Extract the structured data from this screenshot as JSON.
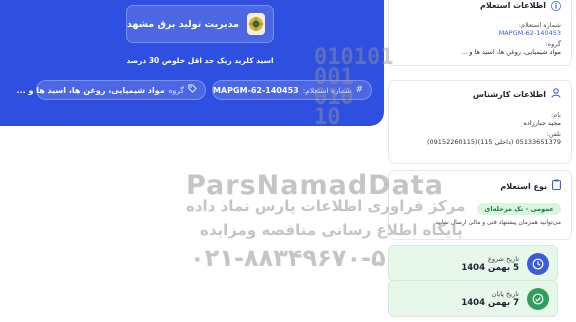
{
  "banner": {
    "org_name": "مدیریت تولید برق مشهد",
    "title": "اسید کلرید ریک حد اقل خلوص 30 درصد",
    "number_label": "شماره استعلام:",
    "number_value": "MAPGM-62-140453",
    "group_label": "گروه",
    "group_value": "مواد شیمیایی، روغن ها، اسید ها و ..."
  },
  "inquiry_info": {
    "title": "اطلاعات استعلام",
    "number_label": "شماره استعلام:",
    "number_value": "MAPGM-62-140453",
    "group_label": "گروه:",
    "group_value": "مواد شیمیایی، روغن ها، اسید ها و ..."
  },
  "expert_info": {
    "title": "اطلاعات کارشناس",
    "name_label": "نام:",
    "name_value": "مجید جبارزاده",
    "phone_label": "تلفن:",
    "phone_value": "05133651379 (داخلی 115)(09152260115)"
  },
  "inquiry_type": {
    "title": "نوع استعلام",
    "chip": "عمومی - تک مرحله‌ای",
    "note": "می‌توانید همزمان پیشنهاد فنی و مالی ارسال نمایید"
  },
  "dates": {
    "start_label": "تاریخ شروع",
    "start_value": "5 بهمن 1404",
    "end_label": "تاریخ پایان",
    "end_value": "7 بهمن 1404"
  },
  "watermark": {
    "brand": "ParsNamadData",
    "line1": "مرکز فراوری اطلاعات پارس نماد داده",
    "line2": "پایگاه اطلاع رسانی مناقصه ومزایده",
    "phone": "۰۲۱-۸۸۳۴۹۶۷۰-۵",
    "digits": "010101\n001\n010\n10"
  },
  "colors": {
    "banner": "#2e4fe0",
    "accent": "#3b5bdb",
    "success": "#1c7c3a"
  },
  "icons": {
    "org_logo": "emblem-icon",
    "number": "hash-icon",
    "group": "tag-icon",
    "info": "info-icon",
    "expert": "user-icon",
    "type": "clipboard-icon",
    "start": "clock-icon",
    "end": "check-circle-icon"
  }
}
